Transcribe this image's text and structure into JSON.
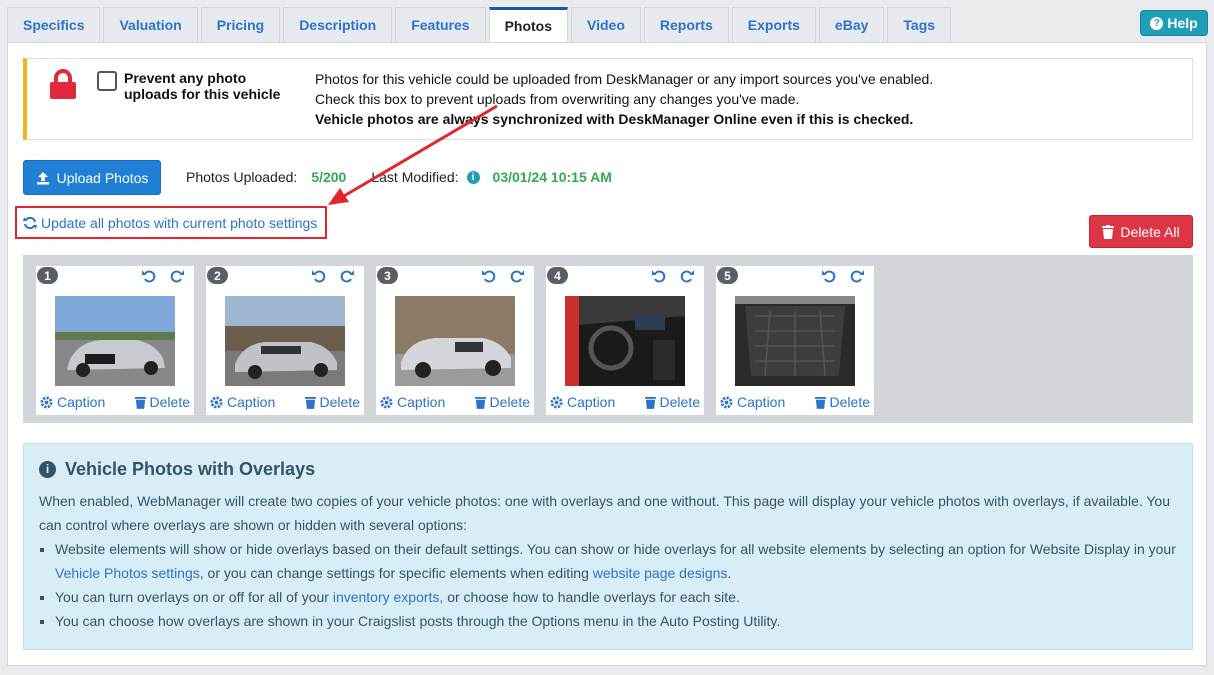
{
  "tabs": [
    "Specifics",
    "Valuation",
    "Pricing",
    "Description",
    "Features",
    "Photos",
    "Video",
    "Reports",
    "Exports",
    "eBay",
    "Tags"
  ],
  "active_tab": "Photos",
  "help_label": "Help",
  "warning": {
    "checkbox_label": "Prevent any photo uploads for this vehicle",
    "line1": "Photos for this vehicle could be uploaded from DeskManager or any import sources you've enabled.",
    "line2": "Check this box to prevent uploads from overwriting any changes you've made.",
    "line3": "Vehicle photos are always synchronized with DeskManager Online even if this is checked."
  },
  "toolbar": {
    "upload_label": "Upload Photos",
    "photos_uploaded_label": "Photos Uploaded:",
    "photos_uploaded_value": "5/200",
    "last_modified_label": "Last Modified:",
    "last_modified_value": "03/01/24 10:15 AM",
    "update_link": "Update all photos with current photo settings",
    "delete_all_label": "Delete All"
  },
  "photos": [
    {
      "num": "1",
      "caption": "Caption",
      "delete": "Delete"
    },
    {
      "num": "2",
      "caption": "Caption",
      "delete": "Delete"
    },
    {
      "num": "3",
      "caption": "Caption",
      "delete": "Delete"
    },
    {
      "num": "4",
      "caption": "Caption",
      "delete": "Delete"
    },
    {
      "num": "5",
      "caption": "Caption",
      "delete": "Delete"
    }
  ],
  "info": {
    "title": "Vehicle Photos with Overlays",
    "intro": "When enabled, WebManager will create two copies of your vehicle photos: one with overlays and one without. This page will display your vehicle photos with overlays, if available. You can control where overlays are shown or hidden with several options:",
    "b1_pre": "Website elements will show or hide overlays based on their default settings. You can show or hide overlays for all website elements by selecting an option for Website Display in your ",
    "b1_link1": "Vehicle Photos settings",
    "b1_mid": ", or you can change settings for specific elements when editing ",
    "b1_link2": "website page designs",
    "b1_end": ".",
    "b2_pre": "You can turn overlays on or off for all of your ",
    "b2_link": "inventory exports,",
    "b2_end": " or choose how to handle overlays for each site.",
    "b3": "You can choose how overlays are shown in your Craigslist posts through the Options menu in the Auto Posting Utility."
  },
  "colors": {
    "accent": "#1f80d6",
    "success": "#34a853",
    "danger": "#dc3545",
    "warning_bar": "#f3b41c",
    "highlight": "#e3262b"
  }
}
